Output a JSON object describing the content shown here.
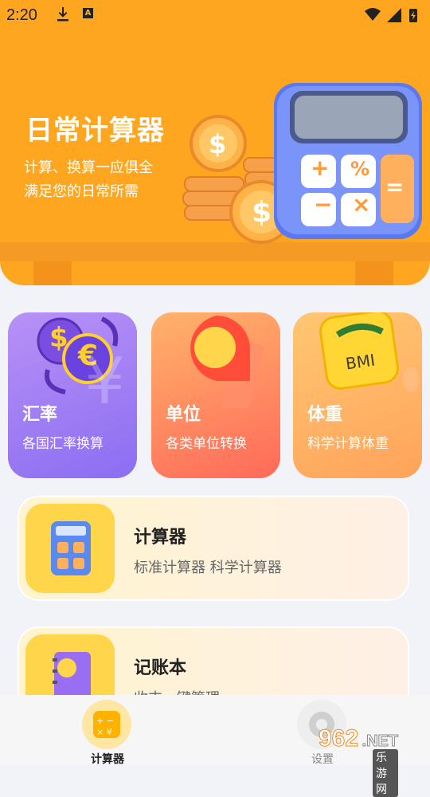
{
  "status_bar": {
    "time": "2:20",
    "a_badge": "A"
  },
  "hero": {
    "title": "日常计算器",
    "subtitle_line1": "计算、换算一应俱全",
    "subtitle_line2": "满足您的日常所需",
    "calculator_keys": [
      "+",
      "%",
      "=",
      "−",
      "×"
    ]
  },
  "cards": [
    {
      "name": "汇率",
      "desc": "各国汇率换算",
      "icon": "currency-exchange-icon",
      "symbols": [
        "$",
        "€",
        "¥"
      ]
    },
    {
      "name": "单位",
      "desc": "各类单位转换",
      "icon": "ruler-pin-icon"
    },
    {
      "name": "体重",
      "desc": "科学计算体重",
      "icon": "bmi-scale-icon",
      "badge": "BMI"
    }
  ],
  "rows": [
    {
      "title": "计算器",
      "desc": "标准计算器  科学计算器",
      "icon": "calculator-icon"
    },
    {
      "title": "记账本",
      "desc": "收支一键管理",
      "icon": "notebook-icon"
    }
  ],
  "nav": {
    "items": [
      {
        "label": "计算器",
        "icon": "calculator-tab-icon",
        "active": true
      },
      {
        "label": "设置",
        "icon": "gear-icon",
        "active": false
      }
    ]
  },
  "watermark": {
    "main": "962",
    "suffix": ".NET",
    "sub": "乐游网"
  },
  "colors": {
    "hero": "#ffa620",
    "card_rate": "#9b7cf4",
    "card_unit": "#ff7f5e",
    "card_weight": "#ffb066",
    "row_bg": "#fff4d8",
    "nav_active": "#ffe6a3"
  }
}
